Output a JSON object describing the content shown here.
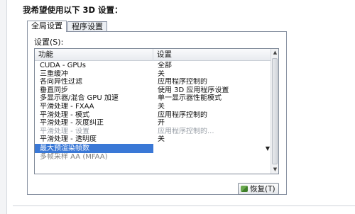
{
  "dialog": {
    "heading": "我希望使用以下 3D 设置：",
    "tabs": [
      {
        "label": "全局设置"
      },
      {
        "label": "程序设置"
      }
    ],
    "settings_label": "设置(S):",
    "columns": {
      "feature": "功能",
      "setting": "设置"
    },
    "rows": [
      {
        "feature": "CUDA - GPUs",
        "setting": "全部"
      },
      {
        "feature": "三重缓冲",
        "setting": "关"
      },
      {
        "feature": "各向异性过滤",
        "setting": "应用程序控制的"
      },
      {
        "feature": "垂直同步",
        "setting": "使用 3D 应用程序设置"
      },
      {
        "feature": "多显示器/混合 GPU 加速",
        "setting": "单一显示器性能模式"
      },
      {
        "feature": "平滑处理 - FXAA",
        "setting": "关"
      },
      {
        "feature": "平滑处理 - 模式",
        "setting": "应用程序控制的"
      },
      {
        "feature": "平滑处理 - 灰度纠正",
        "setting": "开"
      },
      {
        "feature": "平滑处理 - 设置",
        "setting": "应用程序控制的..."
      },
      {
        "feature": "平滑处理 - 透明度",
        "setting": "关"
      },
      {
        "feature": "最大预渲染帧数",
        "setting": ""
      },
      {
        "feature": "多帧采样 AA (MFAA)",
        "setting": ""
      }
    ],
    "restore_label": "恢复(T)"
  },
  "colors": {
    "selection": "#3a78d6",
    "border": "#8a93a3",
    "shield": "#6aa84f"
  }
}
